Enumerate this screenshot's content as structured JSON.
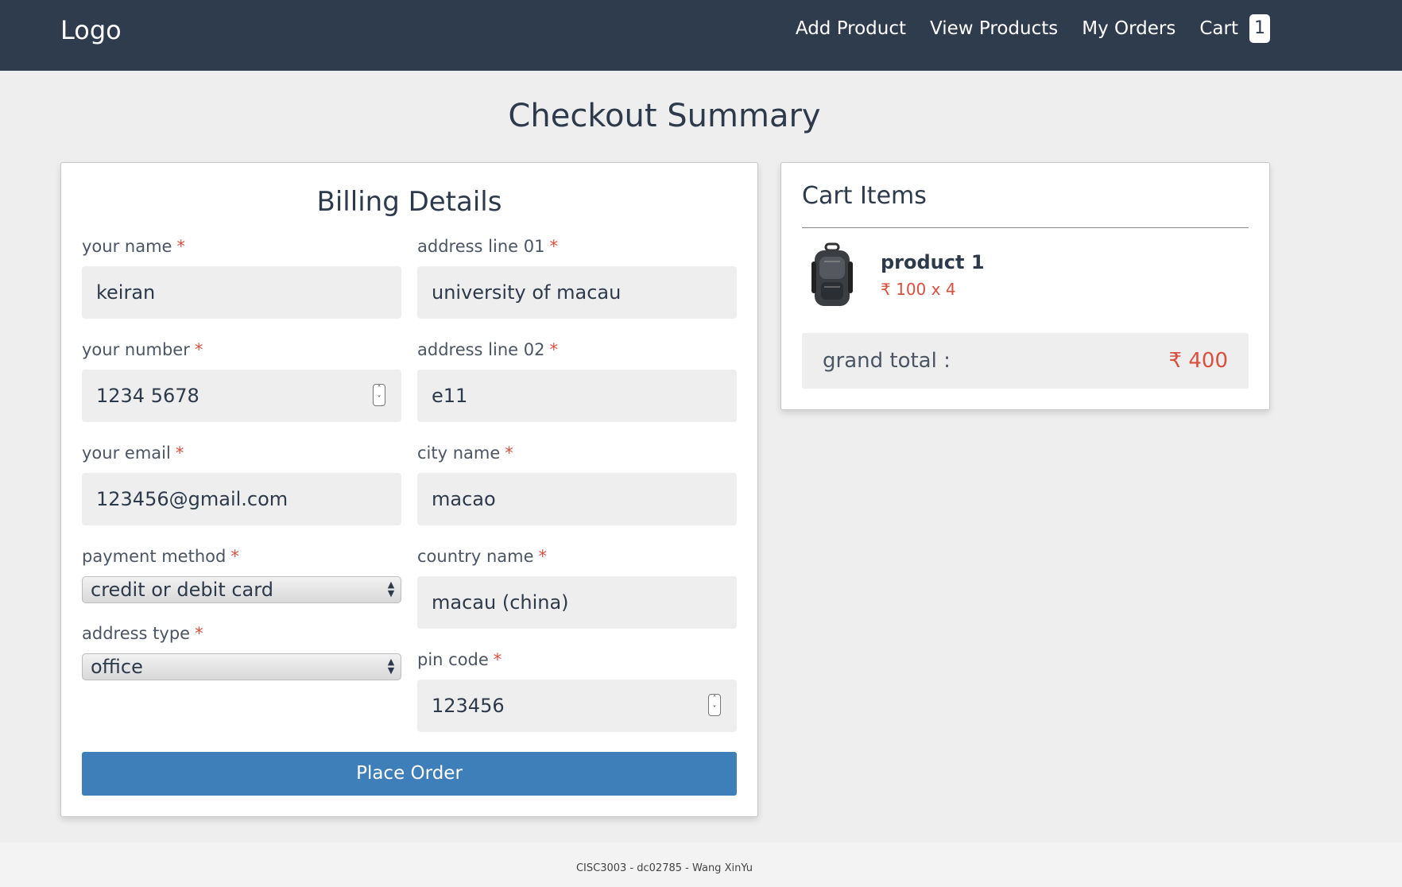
{
  "header": {
    "logo": "Logo",
    "nav": {
      "add_product": "Add Product",
      "view_products": "View Products",
      "my_orders": "My Orders",
      "cart": "Cart",
      "cart_count": "1"
    }
  },
  "page": {
    "title": "Checkout Summary"
  },
  "billing": {
    "title": "Billing Details",
    "required_mark": "*",
    "fields": {
      "name": {
        "label": "your name",
        "value": "keiran"
      },
      "number": {
        "label": "your number",
        "value": "1234 5678"
      },
      "email": {
        "label": "your email",
        "value": "123456@gmail.com"
      },
      "payment_method": {
        "label": "payment method",
        "value": "credit or debit card"
      },
      "address_type": {
        "label": "address type",
        "value": "office"
      },
      "address_line1": {
        "label": "address line 01",
        "value": "university of macau"
      },
      "address_line2": {
        "label": "address line 02",
        "value": "e11"
      },
      "city": {
        "label": "city name",
        "value": "macao"
      },
      "country": {
        "label": "country name",
        "value": "macau (china)"
      },
      "pin_code": {
        "label": "pin code",
        "value": "123456"
      }
    },
    "place_order_label": "Place Order"
  },
  "cart": {
    "title": "Cart Items",
    "items": [
      {
        "name": "product 1",
        "currency": "₹",
        "price_text": "100 x 4"
      }
    ],
    "grand_total_label": "grand total :",
    "grand_total_currency": "₹",
    "grand_total_value": "400"
  },
  "footer": {
    "text": "CISC3003 - dc02785 - Wang XinYu"
  },
  "colors": {
    "header_bg": "#2f3c4e",
    "accent_red": "#d9503f",
    "button_blue": "#3f7fb9",
    "page_bg": "#eeeeee"
  }
}
